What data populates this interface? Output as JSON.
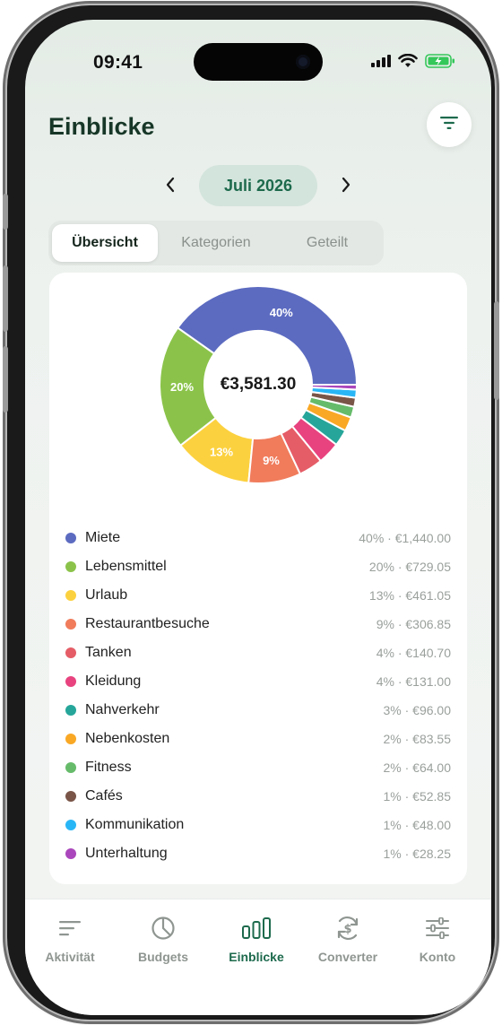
{
  "status_bar": {
    "time": "09:41"
  },
  "header": {
    "title": "Einblicke"
  },
  "month": {
    "label": "Juli 2026"
  },
  "tabs": [
    {
      "label": "Übersicht",
      "active": true
    },
    {
      "label": "Kategorien",
      "active": false
    },
    {
      "label": "Geteilt",
      "active": false
    }
  ],
  "total": "€3,581.30",
  "chart_data": {
    "type": "pie",
    "categories": [
      "Miete",
      "Lebensmittel",
      "Urlaub",
      "Restaurantbesuche",
      "Tanken",
      "Kleidung",
      "Nahverkehr",
      "Nebenkosten",
      "Fitness",
      "Cafés",
      "Kommunikation",
      "Unterhaltung"
    ],
    "values": [
      1440.0,
      729.05,
      461.05,
      306.85,
      140.7,
      131.0,
      96.0,
      83.55,
      64.0,
      52.85,
      48.0,
      28.25
    ],
    "colors": [
      "#5c6bc0",
      "#8bc34a",
      "#fcd13f",
      "#f07c5c",
      "#e55d67",
      "#e8437f",
      "#26a69a",
      "#f9a825",
      "#66bb6a",
      "#795548",
      "#29b6f6",
      "#ab47bc"
    ],
    "slice_labels": [
      "40%",
      "20%",
      "13%",
      "9%"
    ],
    "center_label": "€3,581.30"
  },
  "legend": [
    {
      "name": "Miete",
      "value": "40% · €1,440.00",
      "color": "#5c6bc0"
    },
    {
      "name": "Lebensmittel",
      "value": "20% · €729.05",
      "color": "#8bc34a"
    },
    {
      "name": "Urlaub",
      "value": "13% · €461.05",
      "color": "#fcd13f"
    },
    {
      "name": "Restaurantbesuche",
      "value": "9% · €306.85",
      "color": "#f07c5c"
    },
    {
      "name": "Tanken",
      "value": "4% · €140.70",
      "color": "#e55d67"
    },
    {
      "name": "Kleidung",
      "value": "4% · €131.00",
      "color": "#e8437f"
    },
    {
      "name": "Nahverkehr",
      "value": "3% · €96.00",
      "color": "#26a69a"
    },
    {
      "name": "Nebenkosten",
      "value": "2% · €83.55",
      "color": "#f9a825"
    },
    {
      "name": "Fitness",
      "value": "2% · €64.00",
      "color": "#66bb6a"
    },
    {
      "name": "Cafés",
      "value": "1% · €52.85",
      "color": "#795548"
    },
    {
      "name": "Kommunikation",
      "value": "1% · €48.00",
      "color": "#29b6f6"
    },
    {
      "name": "Unterhaltung",
      "value": "1% · €28.25",
      "color": "#ab47bc"
    }
  ],
  "nav": [
    {
      "label": "Aktivität",
      "icon": "activity-list-icon",
      "active": false
    },
    {
      "label": "Budgets",
      "icon": "pie-chart-icon",
      "active": false
    },
    {
      "label": "Einblicke",
      "icon": "bar-chart-icon",
      "active": true
    },
    {
      "label": "Converter",
      "icon": "currency-convert-icon",
      "active": false
    },
    {
      "label": "Konto",
      "icon": "sliders-icon",
      "active": false
    }
  ],
  "colors": {
    "accent": "#1d6a4d",
    "title": "#173728",
    "muted": "#8f9691"
  }
}
